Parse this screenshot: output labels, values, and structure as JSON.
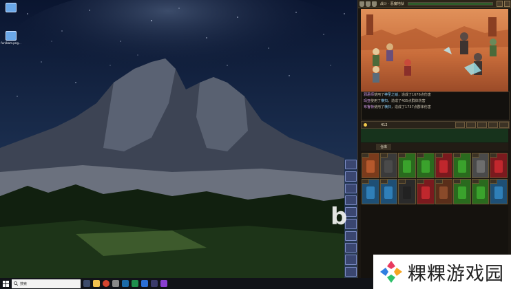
{
  "desktop": {
    "icons": [
      {
        "label": ""
      },
      {
        "label": "fun/bam.png..."
      }
    ]
  },
  "game": {
    "stage_label": "战斗 · 恶魔地狱",
    "log": [
      {
        "who": "邪恶师",
        "pre": "使用了",
        "skill": "神圣之锤",
        "post": "，造成了1676点伤害"
      },
      {
        "who": "玛亚",
        "pre": "使用了",
        "skill": "横扫",
        "post": "，造成了405点群体伤害"
      },
      {
        "who": "布鲁特",
        "pre": "使用了",
        "skill": "横扫",
        "post": "，造成了1737点群体伤害"
      }
    ],
    "gold": "412",
    "bag_tab": "仓库",
    "item_colors": [
      "#b5582c",
      "#4a4a4a",
      "#3aa22c",
      "#3aa22c",
      "#c0272d",
      "#3aa22c",
      "#6d6d6d",
      "#c0272d",
      "#2f7fb8",
      "#2f7fb8",
      "#222222",
      "#c0272d",
      "#8a4a2a",
      "#3aa22c",
      "#3aa22c",
      "#2f7fb8"
    ]
  },
  "watermark": {
    "big_letter": "b",
    "site_name": "粿粿游戏园"
  },
  "taskbar": {
    "search_placeholder": "搜索"
  }
}
